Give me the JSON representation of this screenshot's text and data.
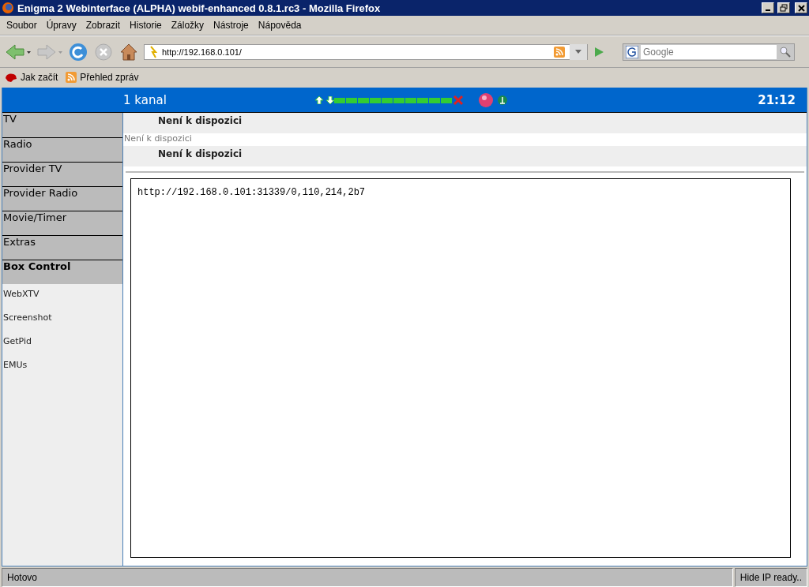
{
  "window": {
    "title": "Enigma 2 Webinterface (ALPHA) webif-enhanced 0.8.1.rc3 - Mozilla Firefox"
  },
  "menu": [
    "Soubor",
    "Úpravy",
    "Zobrazit",
    "Historie",
    "Záložky",
    "Nástroje",
    "Nápověda"
  ],
  "address_bar": {
    "value": "http://192.168.0.101/"
  },
  "search": {
    "placeholder": "Google"
  },
  "bookmarks": [
    {
      "label": "Jak začít",
      "kind": "start"
    },
    {
      "label": "Přehled zpráv",
      "kind": "feed"
    }
  ],
  "header": {
    "channel": "1 kanal",
    "time": "21:12"
  },
  "sidebar": {
    "items": [
      {
        "label": "TV",
        "selected": false
      },
      {
        "label": "Radio",
        "selected": false
      },
      {
        "label": "Provider TV",
        "selected": false
      },
      {
        "label": "Provider Radio",
        "selected": false
      },
      {
        "label": "Movie/Timer",
        "selected": false
      },
      {
        "label": "Extras",
        "selected": false
      },
      {
        "label": "Box Control",
        "selected": true,
        "children": [
          {
            "label": "WebXTV"
          },
          {
            "label": "Screenshot"
          },
          {
            "label": "GetPid"
          },
          {
            "label": "EMUs"
          }
        ]
      }
    ]
  },
  "info": {
    "now": "Není k dispozici",
    "description": "Není k dispozici",
    "next": "Není k dispozici"
  },
  "stream_url": "http://192.168.0.101:31339/0,110,214,2b7",
  "status_bar": {
    "left": "Hotovo",
    "right": "Hide IP ready.."
  }
}
